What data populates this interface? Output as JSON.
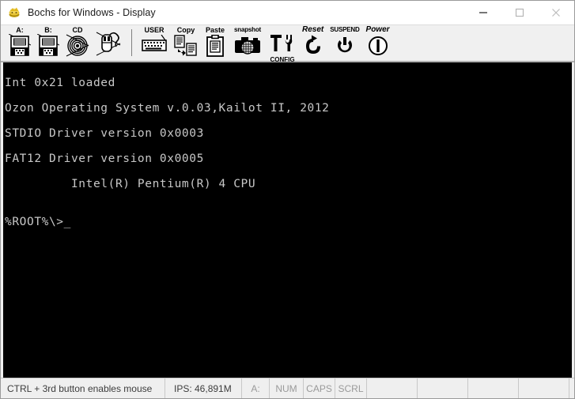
{
  "window": {
    "title": "Bochs for Windows - Display",
    "app_icon": "bochs-logo-icon",
    "controls": {
      "minimize": "minimize-icon",
      "maximize": "maximize-icon",
      "close": "close-icon"
    }
  },
  "toolbar": {
    "items": [
      {
        "id": "floppy-a",
        "label": "A:",
        "icon": "floppy-disk-icon"
      },
      {
        "id": "floppy-b",
        "label": "B:",
        "icon": "floppy-disk-icon"
      },
      {
        "id": "cdrom",
        "label": "CD",
        "icon": "cdrom-icon"
      },
      {
        "id": "mouse",
        "label": "",
        "icon": "mouse-icon"
      },
      {
        "id": "user",
        "label": "USER",
        "icon": "keyboard-icon"
      },
      {
        "id": "copy",
        "label": "Copy",
        "icon": "copy-icon"
      },
      {
        "id": "paste",
        "label": "Paste",
        "icon": "paste-icon"
      },
      {
        "id": "snapshot",
        "label": "snapshot",
        "icon": "camera-icon"
      },
      {
        "id": "config",
        "label": "CONFIG",
        "icon": "tools-icon"
      },
      {
        "id": "reset",
        "label": "Reset",
        "icon": "reset-arrow-icon"
      },
      {
        "id": "suspend",
        "label": "SUSPEND",
        "icon": "suspend-icon"
      },
      {
        "id": "power",
        "label": "Power",
        "icon": "power-icon"
      }
    ]
  },
  "screen": {
    "background": "#000000",
    "foreground": "#c8c8c8",
    "lines": [
      "Int 0x21 loaded",
      "Ozon Operating System v.0.03,Kailot II, 2012",
      "STDIO Driver version 0x0003",
      "FAT12 Driver version 0x0005",
      "         Intel(R) Pentium(R) 4 CPU",
      ""
    ],
    "prompt": "%ROOT%\\>",
    "cursor": "_"
  },
  "statusbar": {
    "message": "CTRL + 3rd button enables mouse",
    "ips": "IPS: 46,891M",
    "leds": [
      {
        "id": "floppy-a-led",
        "label": "A:"
      },
      {
        "id": "num-led",
        "label": "NUM"
      },
      {
        "id": "caps-led",
        "label": "CAPS"
      },
      {
        "id": "scrl-led",
        "label": "SCRL"
      }
    ],
    "blank_cells": 5
  }
}
